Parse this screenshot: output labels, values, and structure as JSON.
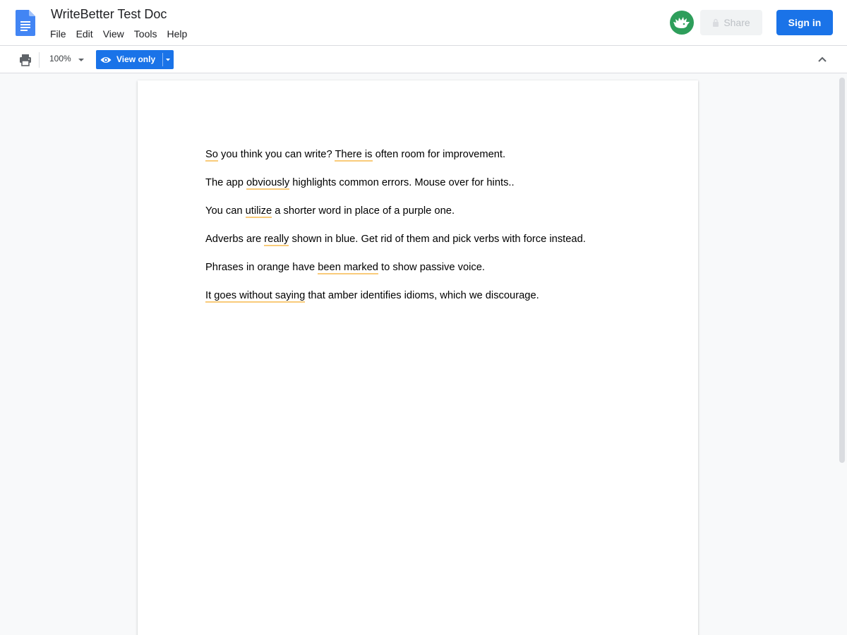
{
  "header": {
    "title": "WriteBetter Test Doc",
    "menu": [
      "File",
      "Edit",
      "View",
      "Tools",
      "Help"
    ],
    "avatar_icon": "hedgehog-icon",
    "share_label": "Share",
    "signin_label": "Sign in"
  },
  "toolbar": {
    "zoom": "100%",
    "mode_label": "View only"
  },
  "document": {
    "paragraphs": [
      [
        {
          "t": "So",
          "hl": true
        },
        {
          "t": " you think you can write? "
        },
        {
          "t": "There is",
          "hl": true
        },
        {
          "t": " often room for improvement."
        }
      ],
      [
        {
          "t": "The app "
        },
        {
          "t": "obviously",
          "hl": true
        },
        {
          "t": " highlights common errors. Mouse over for hints.."
        }
      ],
      [
        {
          "t": "You can "
        },
        {
          "t": "utilize",
          "hl": true
        },
        {
          "t": " a shorter word in place of a purple one."
        }
      ],
      [
        {
          "t": "Adverbs are "
        },
        {
          "t": "really",
          "hl": true
        },
        {
          "t": " shown in blue. Get rid of them and pick verbs with force instead."
        }
      ],
      [
        {
          "t": "Phrases in orange have "
        },
        {
          "t": "been marked",
          "hl": true
        },
        {
          "t": " to show passive voice."
        }
      ],
      [
        {
          "t": "It goes without saying",
          "hl": true
        },
        {
          "t": " that amber identifies idioms, which we discourage."
        }
      ]
    ]
  },
  "colors": {
    "accent": "#1a73e8",
    "highlight": "#f9cb7a",
    "avatar": "#2e9e5b"
  }
}
